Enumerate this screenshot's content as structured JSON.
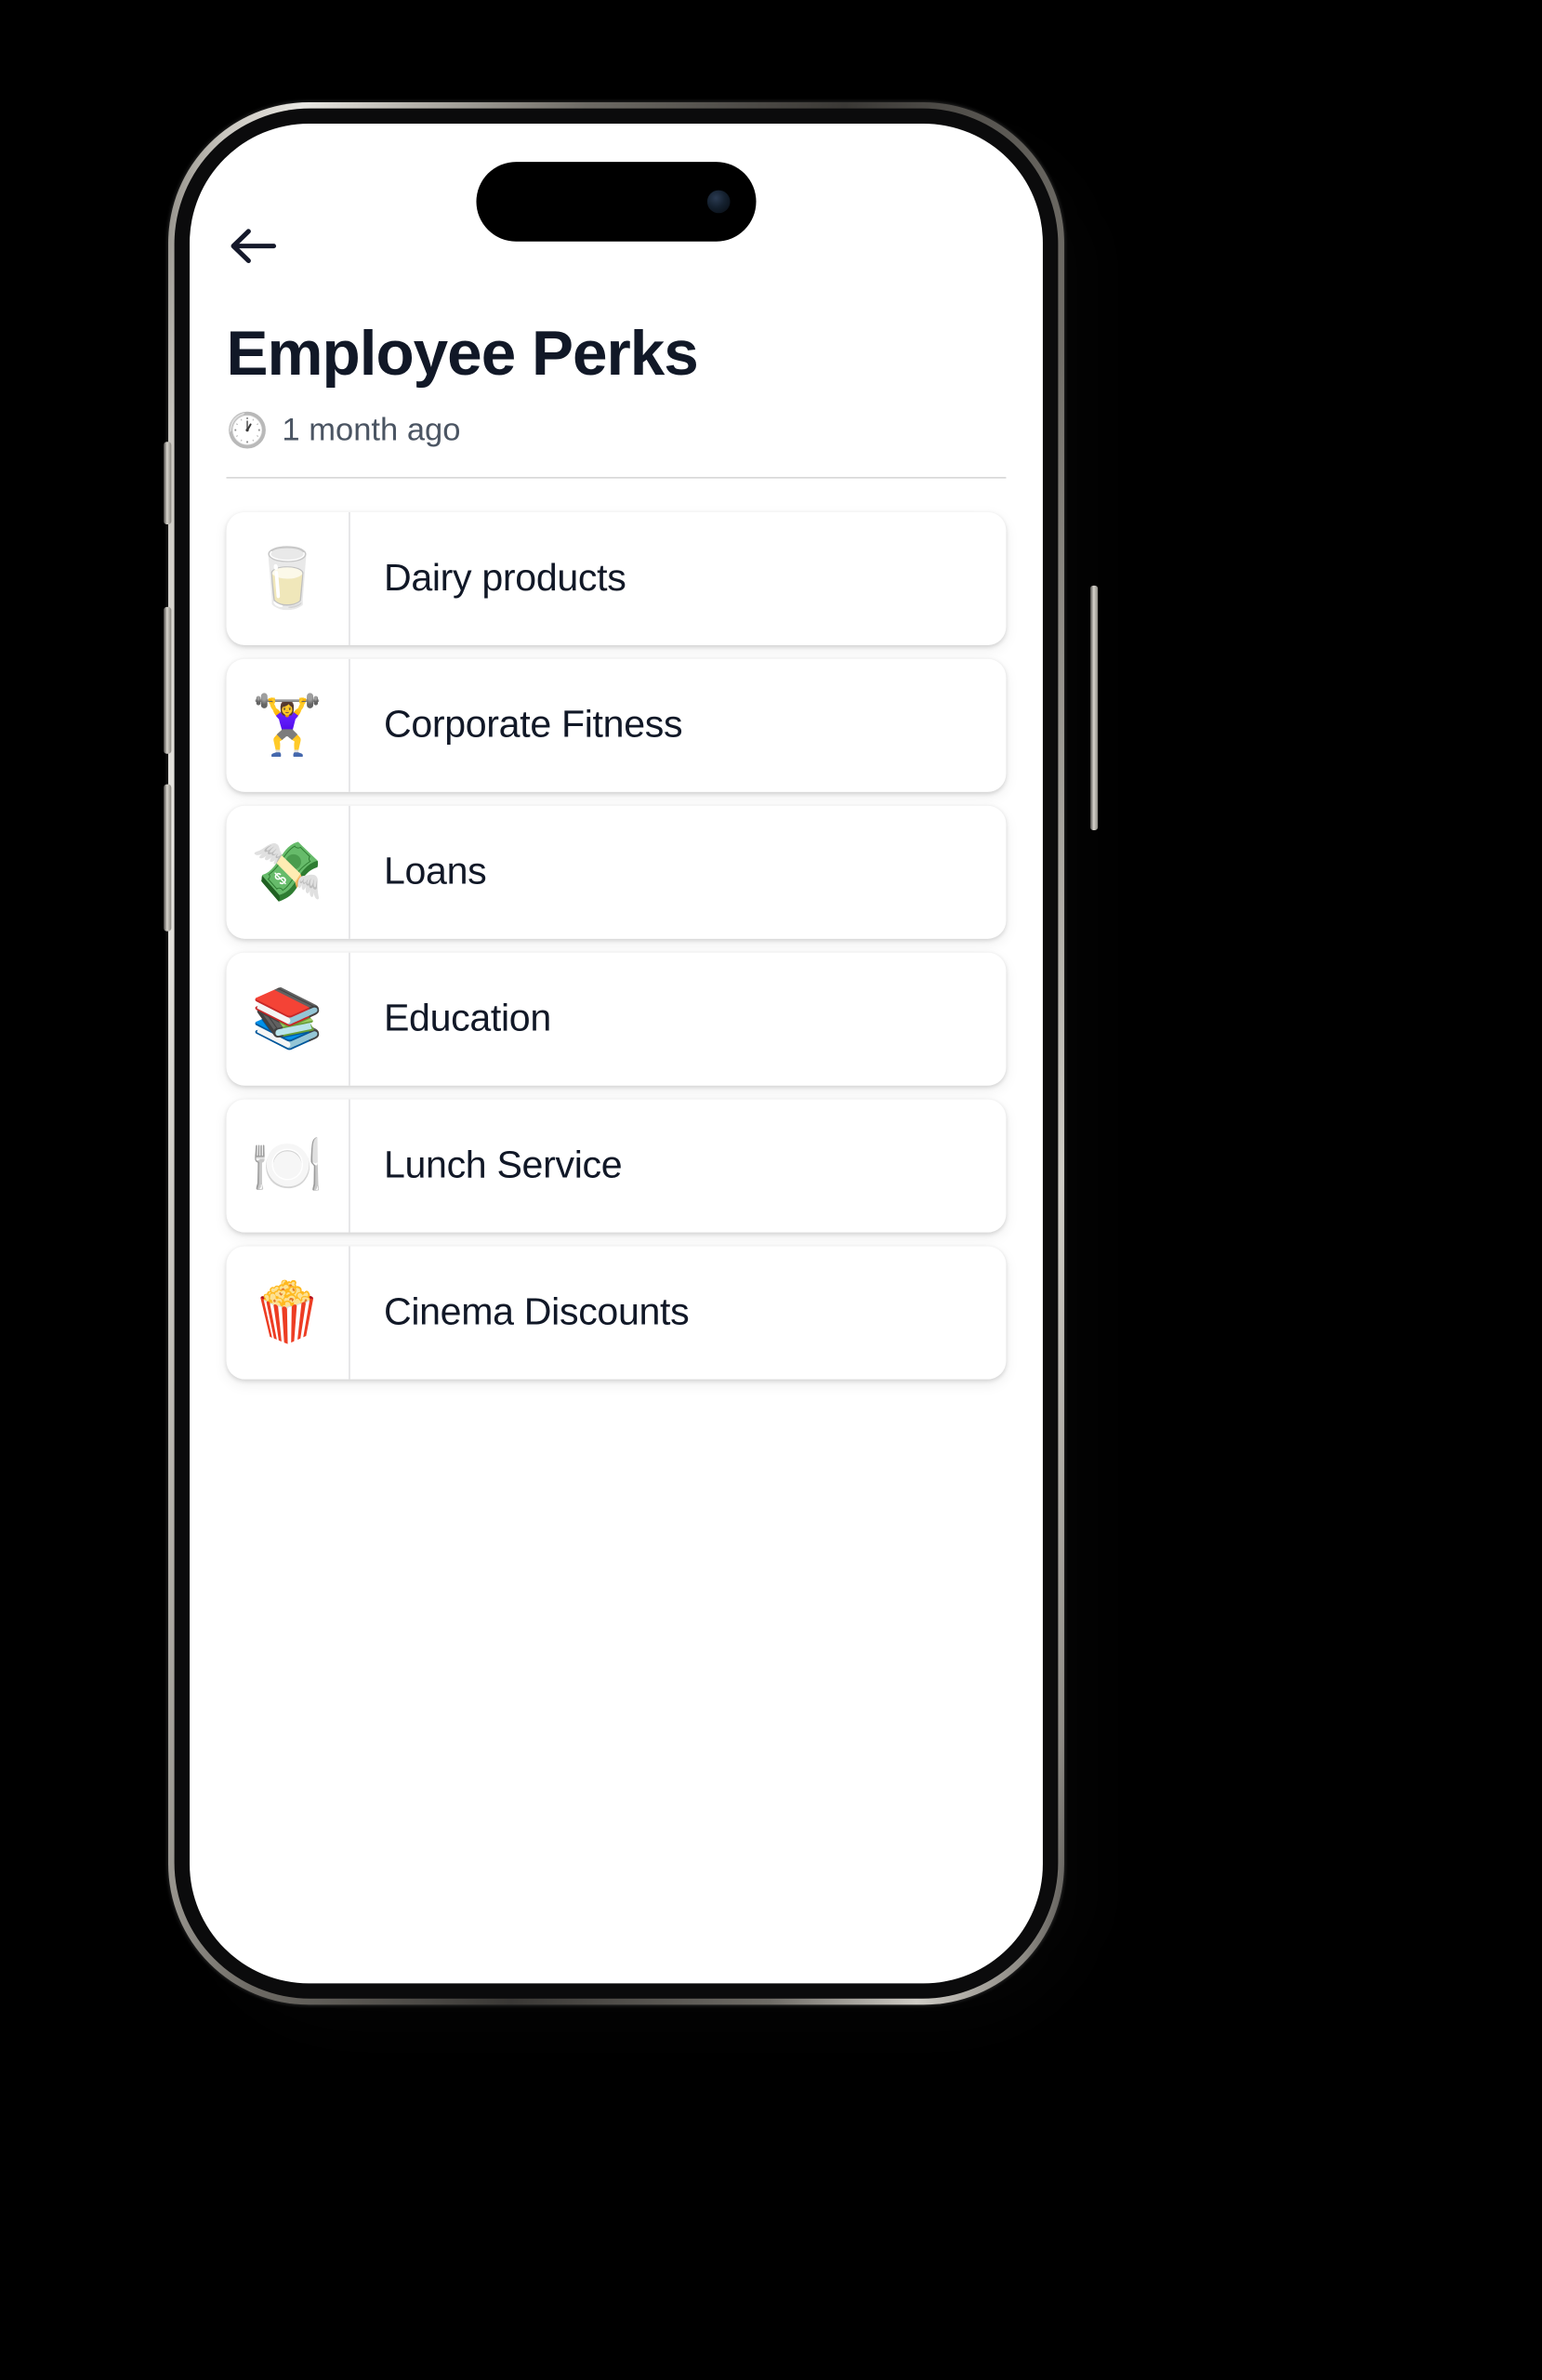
{
  "device": {
    "type": "smartphone-mockup",
    "dynamic_island": "dynamic-island",
    "camera": "front-camera-dot",
    "buttons": [
      "action-button",
      "volume-up-button",
      "volume-down-button",
      "power-button"
    ]
  },
  "nav": {
    "back_icon": "arrow-left-icon",
    "back_label": "Back"
  },
  "header": {
    "title": "Employee Perks",
    "time_icon": "clock-icon",
    "timestamp": "1 month ago"
  },
  "colors": {
    "background": "#000000",
    "screen": "#ffffff",
    "text_primary": "#111827",
    "text_secondary": "#4b5563",
    "divider": "#d8d8d8",
    "card_divider": "#e2e2e4"
  },
  "perks": [
    {
      "icon": "🥛",
      "icon_name": "glass-of-milk-icon",
      "label": "Dairy products"
    },
    {
      "icon": "🏋️‍♀️",
      "icon_name": "weightlifter-icon",
      "label": "Corporate Fitness"
    },
    {
      "icon": "💸",
      "icon_name": "money-with-wings-icon",
      "label": "Loans"
    },
    {
      "icon": "📚",
      "icon_name": "books-icon",
      "label": "Education"
    },
    {
      "icon": "🍽️",
      "icon_name": "fork-knife-plate-icon",
      "label": "Lunch Service"
    },
    {
      "icon": "🍿",
      "icon_name": "popcorn-icon",
      "label": "Cinema Discounts"
    }
  ]
}
